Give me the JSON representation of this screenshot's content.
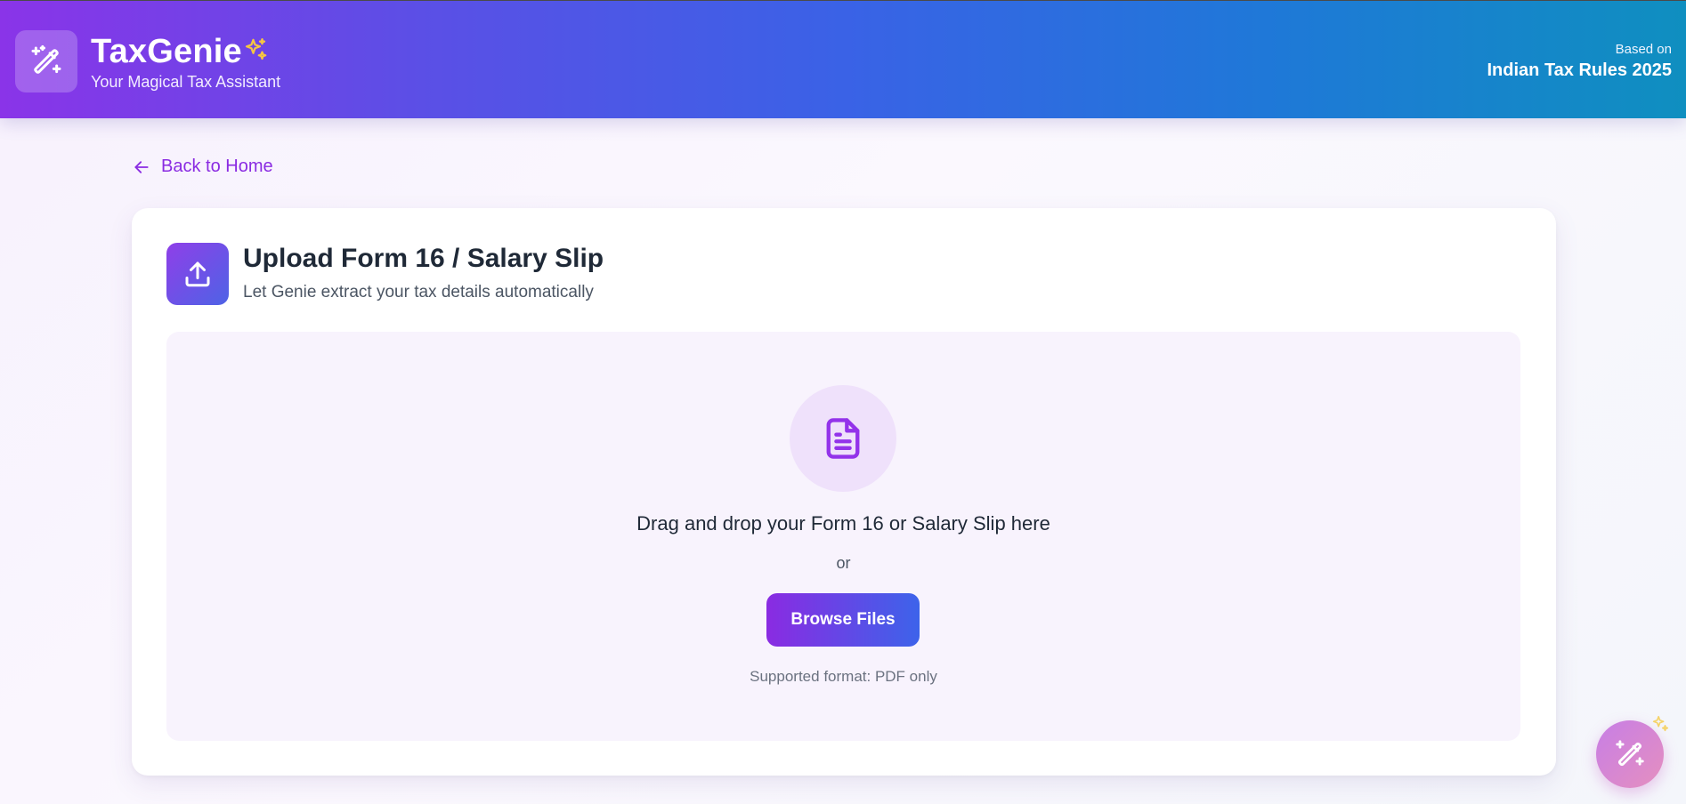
{
  "header": {
    "title": "TaxGenie",
    "subtitle": "Your Magical Tax Assistant",
    "based_on_label": "Based on",
    "rules_label": "Indian Tax Rules 2025",
    "logo_icon": "magic-wand-icon",
    "sparkle_icon": "sparkles-icon"
  },
  "nav": {
    "back_label": "Back to Home",
    "back_icon": "arrow-left-icon"
  },
  "upload_card": {
    "title": "Upload Form 16 / Salary Slip",
    "subtitle": "Let Genie extract your tax details automatically",
    "header_icon": "upload-icon",
    "dropzone": {
      "icon": "file-text-icon",
      "instruction": "Drag and drop your Form 16 or Salary Slip here",
      "or_text": "or",
      "browse_label": "Browse Files",
      "format_note": "Supported format: PDF only"
    }
  },
  "floating_button": {
    "icon": "magic-wand-icon"
  },
  "colors": {
    "accent_purple": "#8a2be2",
    "accent_blue": "#3d63ea",
    "sparkle_yellow": "#f5c542",
    "dropzone_bg": "#f8f3fd"
  }
}
